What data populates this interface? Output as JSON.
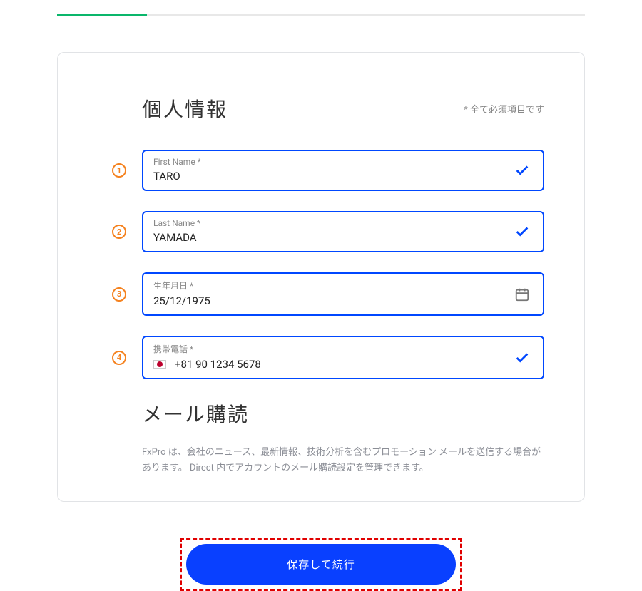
{
  "progress": {
    "percent": 17
  },
  "heading": "個人情報",
  "required_note": "* 全て必須項目です",
  "fields": {
    "first_name": {
      "label": "First Name *",
      "value": "TARO",
      "badge": "1"
    },
    "last_name": {
      "label": "Last Name *",
      "value": "YAMADA",
      "badge": "2"
    },
    "dob": {
      "label": "生年月日 *",
      "value": "25/12/1975",
      "badge": "3"
    },
    "phone": {
      "label": "携帯電話 *",
      "value": "+81 90 1234 5678",
      "badge": "4",
      "country": "JP"
    }
  },
  "mail_section": {
    "heading": "メール購読",
    "desc": "FxPro は、会社のニュース、最新情報、技術分析を含むプロモーション メールを送信する場合があります。 Direct 内でアカウントのメール購読設定を管理できます。"
  },
  "submit_label": "保存して続行"
}
